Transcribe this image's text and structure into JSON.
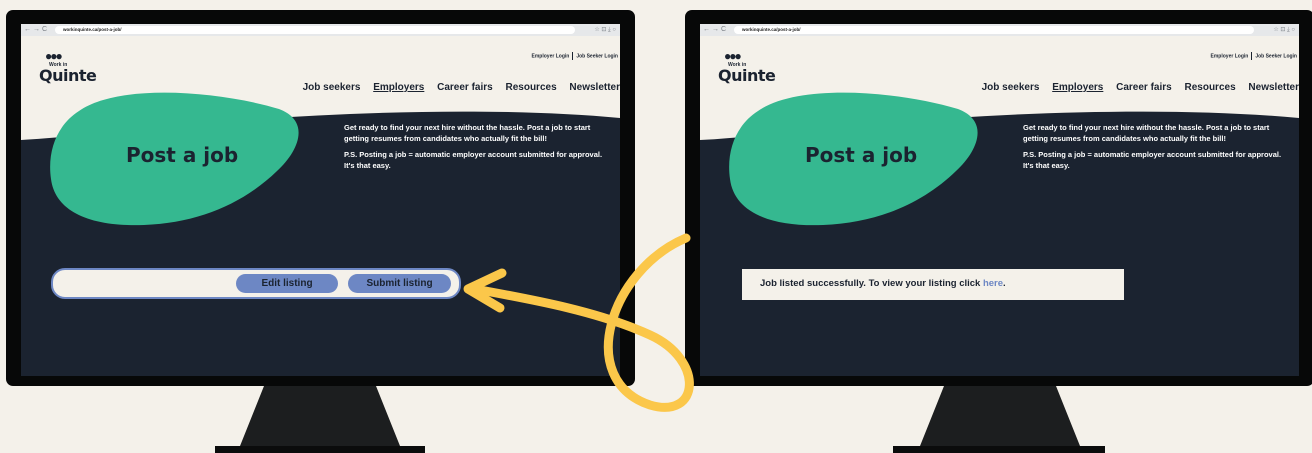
{
  "browser": {
    "url": "workinquinte.ca/post-a-job/",
    "nav": [
      "←",
      "→",
      "C"
    ],
    "icons": "☆  ⊡  ⤓  ○"
  },
  "site": {
    "logo_top": "Work in",
    "logo_name": "Quinte",
    "employer_login": "Employer Login",
    "jobseeker_login": "Job Seeker Login",
    "nav": [
      "Job seekers",
      "Employers",
      "Career fairs",
      "Resources",
      "Newsletter"
    ]
  },
  "hero": {
    "title": "Post a job",
    "paragraph_1": "Get ready to find your next hire without the hassle. Post a job to start getting resumes from candidates who actually fit the bill!",
    "paragraph_2": "P.S. Posting a job = automatic employer account submitted for approval. It's that easy."
  },
  "before": {
    "edit_label": "Edit listing",
    "submit_label": "Submit listing"
  },
  "after": {
    "success_text": "Job listed successfully. To view your listing click ",
    "link_text": "here",
    "tail": "."
  },
  "colors": {
    "accent_green": "#35b890",
    "navy": "#1b2330",
    "button_blue": "#6d87c4",
    "arrow_yellow": "#fbc74a"
  }
}
